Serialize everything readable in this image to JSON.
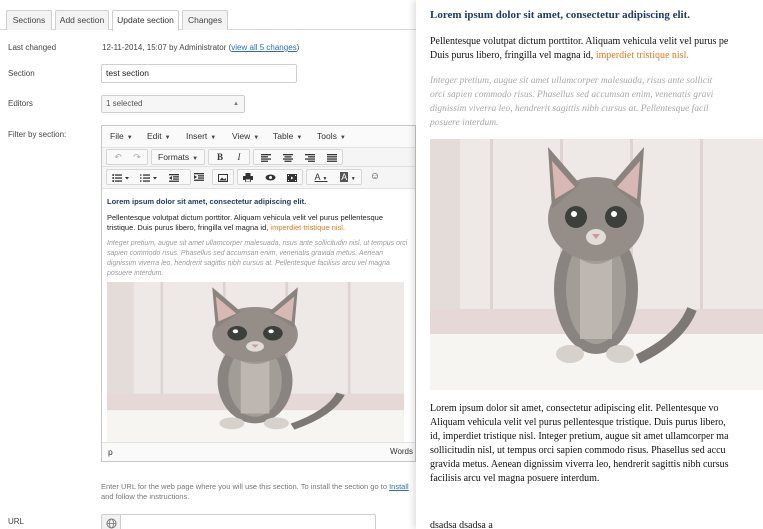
{
  "tabs": [
    {
      "label": "Sections"
    },
    {
      "label": "Add section"
    },
    {
      "label": "Update section",
      "active": true
    },
    {
      "label": "Changes"
    }
  ],
  "form": {
    "last_changed_label": "Last changed",
    "last_changed_value": "12-11-2014, 15:07 by Administrator (",
    "last_changed_link": "view all 5 changes",
    "last_changed_close": ")",
    "section_label": "Section",
    "section_value": "test section",
    "editors_label": "Editors",
    "editors_value": "1 selected",
    "filter_label": "Filter by section:",
    "help_text_1": "Enter URL for the web page where you will use this section. To install the section go to ",
    "help_link": "Install",
    "help_text_2": "and follow the instructions.",
    "url_label": "URL",
    "url_value": ""
  },
  "editor": {
    "menus": [
      "File",
      "Edit",
      "Insert",
      "View",
      "Table",
      "Tools"
    ],
    "formats_label": "Formats",
    "status_path": "p",
    "status_words": "Words",
    "content": {
      "heading": "Lorem ipsum dolor sit amet, consectetur adipiscing elit.",
      "para1_a": "Pellentesque volutpat dictum porttitor. Aliquam vehicula velit vel purus pellentesque tristique. Duis purus libero, fringilla vel magna id, ",
      "para1_link": "imperdiet tristique nisl.",
      "para2": "Integer pretium, augue sit amet ullamcorper malesuada, risus ante sollicitudin nisl, ut tempus orci sapien commodo risus. Phasellus sed accumsan enim, venenatis gravida metus. Aenean dignissim viverra leo, hendrerit sagittis nibh cursus at. Pellentesque facilisis arcu vel magna posuere interdum."
    }
  },
  "preview": {
    "heading": "Lorem ipsum dolor sit amet, consectetur adipiscing elit.",
    "para1_line1": "Pellentesque volutpat dictum porttitor. Aliquam vehicula velit vel purus pe",
    "para1_line2a": "Duis purus libero, fringilla vel magna id, ",
    "para1_link": "imperdiet tristique nisl.",
    "para2_lines": [
      "Integer pretium, augue sit amet ullamcorper malesuada, risus ante sollicit",
      "orci sapien commodo risus. Phasellus sed accumsan enim, venenatis gravi",
      "dignissim viverra leo, hendrerit sagittis nibh cursus at. Pellentesque facil",
      "posuere interdum."
    ],
    "para3_lines": [
      "Lorem ipsum dolor sit amet, consectetur adipiscing elit. Pellentesque vo",
      "Aliquam vehicula velit vel purus pellentesque tristique. Duis purus libero,",
      "id, imperdiet tristique nisl. Integer pretium, augue sit amet ullamcorper ma",
      "sollicitudin nisl, ut tempus orci sapien commodo risus. Phasellus sed accu",
      "gravida metus. Aenean dignissim viverra leo, hendrerit sagittis nibh cursus",
      "facilisis arcu vel magna posuere interdum."
    ],
    "tail": "dsadsa dsadsa a"
  },
  "colors": {
    "heading": "#1f3a6b",
    "link_orange": "#e37b1e",
    "link_blue": "#2a6ebb"
  }
}
